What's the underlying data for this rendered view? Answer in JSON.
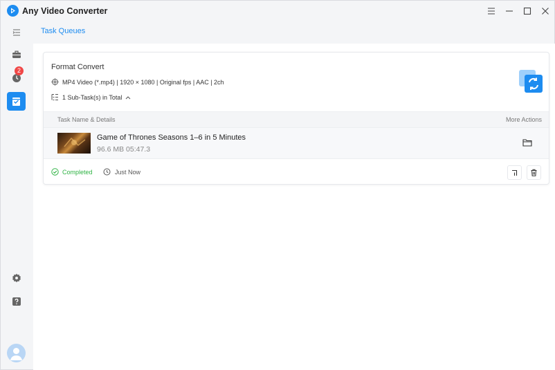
{
  "app": {
    "title": "Any Video Converter"
  },
  "page": {
    "title": "Task Queues"
  },
  "sidebar": {
    "badge_count": "2"
  },
  "task": {
    "title": "Format Convert",
    "format_info": "MP4 Video (*.mp4) | 1920 × 1080 | Original fps | AAC | 2ch",
    "subtasks_label": "1 Sub-Task(s) in Total",
    "table_headers": {
      "name": "Task Name & Details",
      "actions": "More Actions"
    },
    "item": {
      "name": "Game of Thrones Seasons 1–6 in 5 Minutes",
      "meta": "96.6 MB 05:47.3"
    },
    "status_label": "Completed",
    "time_label": "Just Now"
  },
  "colors": {
    "accent": "#1d8cf0",
    "success": "#2fb344",
    "badge": "#f04747"
  },
  "icons": [
    "app-logo-icon",
    "minimize-icon",
    "restore-icon",
    "maximize-icon",
    "close-icon",
    "menu-icon",
    "toolbox-icon",
    "history-icon",
    "task-queue-icon",
    "settings-icon",
    "help-icon",
    "avatar-icon",
    "format-icon",
    "subtask-icon",
    "chevron-up-icon",
    "convert-icon",
    "folder-icon",
    "check-circle-icon",
    "clock-icon",
    "export-icon",
    "trash-icon"
  ]
}
